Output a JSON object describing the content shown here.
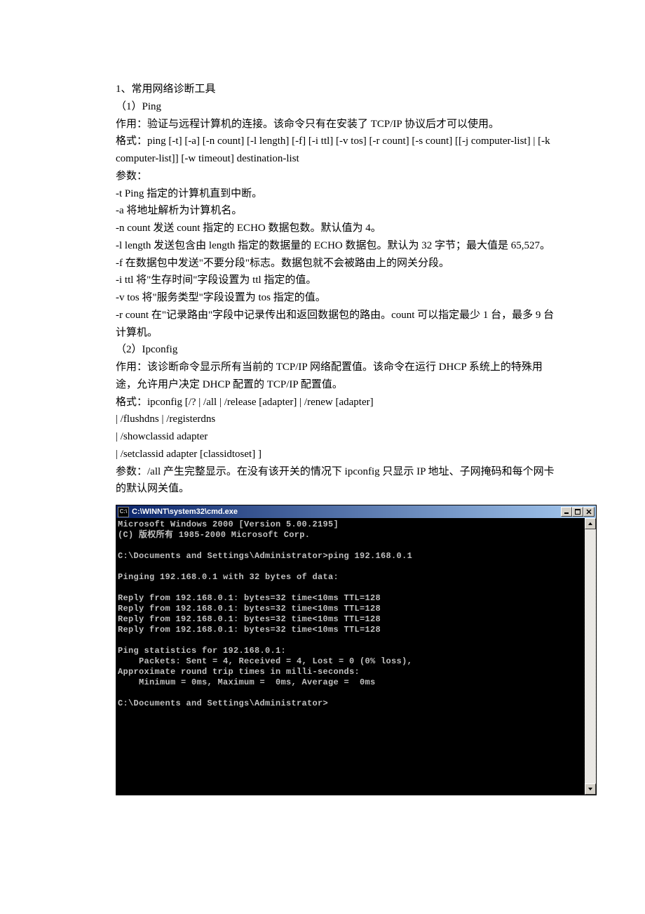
{
  "doc": {
    "lines": [
      "1、常用网络诊断工具",
      "（1）Ping",
      "作用：验证与远程计算机的连接。该命令只有在安装了 TCP/IP 协议后才可以使用。",
      "格式：ping [-t] [-a] [-n count] [-l length] [-f] [-i ttl] [-v tos] [-r count] [-s count] [[-j computer-list] | [-k computer-list]] [-w timeout] destination-list",
      "参数：",
      "-t Ping 指定的计算机直到中断。",
      "-a 将地址解析为计算机名。",
      "-n count 发送 count 指定的 ECHO 数据包数。默认值为 4。",
      "-l length 发送包含由 length 指定的数据量的 ECHO 数据包。默认为 32 字节；最大值是 65,527。",
      "-f 在数据包中发送\"不要分段\"标志。数据包就不会被路由上的网关分段。",
      "-i ttl 将\"生存时间\"字段设置为 ttl 指定的值。",
      "-v tos 将\"服务类型\"字段设置为 tos 指定的值。",
      "-r count 在\"记录路由\"字段中记录传出和返回数据包的路由。count 可以指定最少 1 台，最多 9 台计算机。",
      "（2）Ipconfig",
      "作用：该诊断命令显示所有当前的 TCP/IP 网络配置值。该命令在运行 DHCP 系统上的特殊用途，允许用户决定 DHCP 配置的 TCP/IP 配置值。",
      "格式：ipconfig [/? | /all | /release [adapter] | /renew [adapter]",
      "| /flushdns | /registerdns",
      "| /showclassid adapter",
      "| /setclassid adapter [classidtoset] ]",
      "参数：/all 产生完整显示。在没有该开关的情况下 ipconfig 只显示 IP 地址、子网掩码和每个网卡的默认网关值。"
    ]
  },
  "cmd": {
    "icon_label": "C:\\",
    "title": "C:\\WINNT\\system32\\cmd.exe",
    "lines": [
      "Microsoft Windows 2000 [Version 5.00.2195]",
      "(C) 版权所有 1985-2000 Microsoft Corp.",
      "",
      "C:\\Documents and Settings\\Administrator>ping 192.168.0.1",
      "",
      "Pinging 192.168.0.1 with 32 bytes of data:",
      "",
      "Reply from 192.168.0.1: bytes=32 time<10ms TTL=128",
      "Reply from 192.168.0.1: bytes=32 time<10ms TTL=128",
      "Reply from 192.168.0.1: bytes=32 time<10ms TTL=128",
      "Reply from 192.168.0.1: bytes=32 time<10ms TTL=128",
      "",
      "Ping statistics for 192.168.0.1:",
      "    Packets: Sent = 4, Received = 4, Lost = 0 (0% loss),",
      "Approximate round trip times in milli-seconds:",
      "    Minimum = 0ms, Maximum =  0ms, Average =  0ms",
      "",
      "C:\\Documents and Settings\\Administrator>"
    ]
  }
}
